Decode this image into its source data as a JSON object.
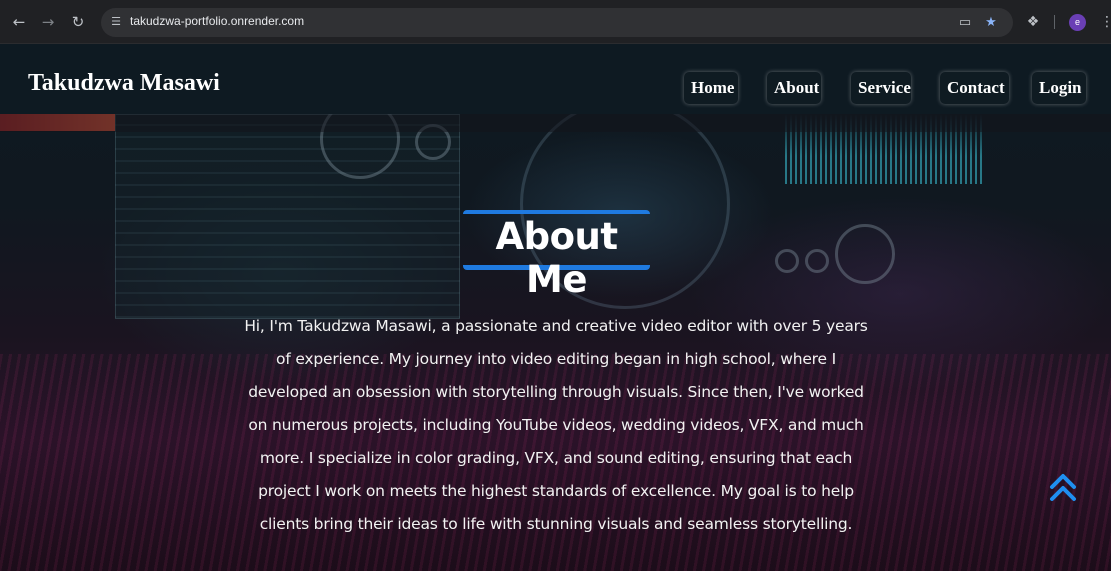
{
  "browser": {
    "url": "takudzwa-portfolio.onrender.com",
    "profile_initial": "e",
    "icons": {
      "back": "arrow-left-icon",
      "forward": "arrow-right-icon",
      "reload": "reload-icon",
      "site_info": "tune-icon",
      "install": "install-app-icon",
      "bookmark": "star-icon",
      "extensions": "puzzle-icon",
      "menu": "kebab-icon"
    }
  },
  "site": {
    "brand": "Takudzwa Masawi",
    "nav": [
      "Home",
      "About",
      "Service",
      "Contact",
      "Login"
    ]
  },
  "about": {
    "title": "About Me",
    "bio": "Hi, I'm Takudzwa Masawi, a passionate and creative video editor with over 5 years of experience. My journey into video editing began in high school, where I developed an obsession with storytelling through visuals. Since then, I've worked on numerous projects, including YouTube videos, wedding videos, VFX, and much more. I specialize in color grading, VFX, and sound editing, ensuring that each project I work on meets the highest standards of excellence. My goal is to help clients bring their ideas to life with stunning visuals and seamless storytelling."
  },
  "colors": {
    "accent": "#1f7ae0",
    "header_bg": "#0e1a22"
  }
}
